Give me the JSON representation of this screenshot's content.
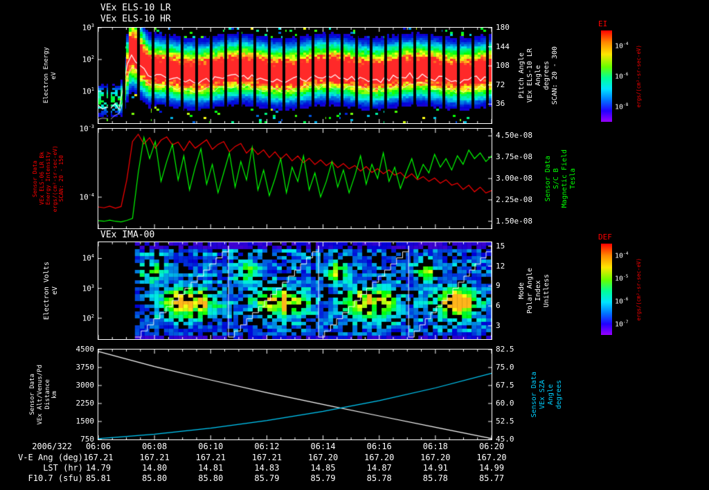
{
  "meta": {
    "background": "#000000",
    "foreground": "#ffffff",
    "accent_red": "#ff0000",
    "accent_green": "#00ff00",
    "accent_cyan": "#00cfff",
    "date": "2006/322",
    "time_range": [
      "06:06",
      "06:20"
    ]
  },
  "titles": {
    "els_line1": "VEx ELS-10 LR",
    "els_line2": "VEx ELS-10 HR",
    "ima": "VEx IMA-00"
  },
  "vertical_labels": {
    "els_left": {
      "color": "#ffffff",
      "lines": [
        "Electron Energy",
        "eV"
      ]
    },
    "els_right": {
      "color": "#ffffff",
      "lines": [
        "Pitch Angle",
        "VEx ELS-10 LR",
        "Angle",
        "degrees",
        "SCAN: 20 - 300"
      ]
    },
    "b_left": {
      "color": "#ff0000",
      "lines": [
        "Sensor Data",
        "VEx ELS-06 LR Bk",
        "Energy Intensity",
        "ergs/(cm²-sr-sec-eV)",
        "SCAN: 20 - 150"
      ]
    },
    "b_right": {
      "color": "#00ff00",
      "lines": [
        "Sensor Data",
        "S/C B",
        "Magnetic Field",
        "Tesla"
      ]
    },
    "ima_left": {
      "color": "#ffffff",
      "lines": [
        "Electron Volts",
        "eV"
      ]
    },
    "ima_right": {
      "color": "#ffffff",
      "lines": [
        "Mode",
        "Polar Angle",
        "Index",
        "Unitless"
      ]
    },
    "traj_left": {
      "color": "#ffffff",
      "lines": [
        "Sensor Data",
        "VEx Alt/Venus/Pd",
        "Distance",
        "km"
      ]
    },
    "traj_right": {
      "color": "#00cfff",
      "lines": [
        "Sensor Data",
        "VEx SZA",
        "Angle",
        "degrees"
      ]
    }
  },
  "colorbars": [
    {
      "title": "EI",
      "units": "ergs/(cm²-sr-sec-eV)",
      "ticks": [
        {
          "label": "10^-4",
          "frac": 0.167
        },
        {
          "label": "10^-6",
          "frac": 0.5
        },
        {
          "label": "10^-8",
          "frac": 0.833
        }
      ]
    },
    {
      "title": "DEF",
      "units": "ergs/(cm²-sr-sec-eV)",
      "ticks": [
        {
          "label": "10^-4",
          "frac": 0.125
        },
        {
          "label": "10^-5",
          "frac": 0.375
        },
        {
          "label": "10^-6",
          "frac": 0.625
        },
        {
          "label": "10^-7",
          "frac": 0.875
        }
      ]
    }
  ],
  "footer": {
    "date_label": "2006/322",
    "time_ticks": [
      "06:06",
      "06:08",
      "06:10",
      "06:12",
      "06:14",
      "06:16",
      "06:18",
      "06:20"
    ],
    "rows": [
      {
        "label": "V-E Ang (deg)",
        "values": [
          "167.21",
          "167.21",
          "167.21",
          "167.21",
          "167.20",
          "167.20",
          "167.20",
          "167.20"
        ]
      },
      {
        "label": "LST (hr)",
        "values": [
          "14.79",
          "14.80",
          "14.81",
          "14.83",
          "14.85",
          "14.87",
          "14.91",
          "14.99"
        ]
      },
      {
        "label": "F10.7 (sfu)",
        "values": [
          "85.81",
          "85.80",
          "85.80",
          "85.79",
          "85.79",
          "85.78",
          "85.78",
          "85.77"
        ]
      }
    ]
  },
  "chart_data": [
    {
      "id": "els_spectrogram",
      "type": "heatmap",
      "title": "VEx ELS-10 LR / VEx ELS-10 HR",
      "xlabel": "UT 06:06 - 06:20 (2006/322)",
      "ylabel": "Electron Energy eV (log)",
      "left_axis": {
        "log": true,
        "lim": [
          1,
          1000
        ],
        "ticks": [
          {
            "v": 1000,
            "label": "10^3"
          },
          {
            "v": 100,
            "label": "10^2"
          },
          {
            "v": 10,
            "label": "10^1"
          }
        ]
      },
      "right_axis": {
        "log": false,
        "lim": [
          0,
          180
        ],
        "label": "Pitch Angle VEx ELS-10 LR Angle degrees SCAN: 20 - 300",
        "ticks": [
          {
            "v": 180,
            "label": "180"
          },
          {
            "v": 144,
            "label": "144"
          },
          {
            "v": 108,
            "label": "108"
          },
          {
            "v": 72,
            "label": "72"
          },
          {
            "v": 36,
            "label": "36"
          }
        ]
      },
      "zunits": "ergs/(cm²-sr-sec-eV)",
      "zticks": [
        "10^-4",
        "10^-6",
        "10^-8"
      ],
      "features": {
        "main_band_eV": [
          8,
          120
        ],
        "band_onset_ut": "06:07",
        "spike_reaches_top": true,
        "scan_gap_count": 26,
        "white_trace": "mean energy line through band"
      },
      "render": {
        "seed": 7,
        "cellw": 4,
        "cellh": 3,
        "gap_start": 14,
        "gap_period": 21,
        "gap_width": 4,
        "quiet_until": 0.055,
        "spike_peak_at": 0.08,
        "settle_at": 0.13,
        "band_center": 0.46,
        "band_sigma": 0.16,
        "gain": 1.35
      }
    },
    {
      "id": "els_intensity_and_b",
      "type": "line",
      "left_axis": {
        "log": true,
        "lim": [
          3.5e-05,
          0.001
        ],
        "units": "ergs/(cm²-sr-sec-eV)",
        "ticks": [
          {
            "v": 0.001,
            "label": "10^-3"
          },
          {
            "v": 0.0001,
            "label": "10^-4"
          }
        ]
      },
      "right_axis": {
        "log": false,
        "lim": [
          1.25e-08,
          4.75e-08
        ],
        "units": "Tesla",
        "ticks": [
          {
            "v": 4.5e-08,
            "label": "4.50e-08"
          },
          {
            "v": 3.75e-08,
            "label": "3.75e-08"
          },
          {
            "v": 3e-08,
            "label": "3.00e-08"
          },
          {
            "v": 2.25e-08,
            "label": "2.25e-08"
          },
          {
            "v": 1.5e-08,
            "label": "1.50e-08"
          }
        ]
      },
      "series": [
        {
          "name": "VEx ELS-06 LR Bk Energy Intensity",
          "color": "#ff0000",
          "axis": "left",
          "scale": 0.0001,
          "values": [
            0.72,
            0.7,
            0.74,
            0.69,
            0.73,
            1.8,
            6.5,
            8.3,
            6.0,
            7.4,
            5.2,
            6.8,
            7.6,
            5.8,
            6.4,
            4.8,
            6.6,
            5.2,
            6.0,
            6.9,
            5.0,
            5.9,
            6.5,
            4.6,
            5.5,
            6.1,
            4.4,
            5.3,
            4.2,
            4.9,
            3.8,
            4.6,
            3.6,
            4.3,
            3.4,
            4.0,
            3.2,
            3.7,
            3.0,
            3.5,
            2.9,
            3.3,
            2.7,
            3.1,
            2.6,
            2.9,
            2.4,
            2.8,
            2.3,
            2.6,
            2.2,
            2.5,
            2.1,
            2.3,
            1.9,
            2.2,
            1.8,
            2.0,
            1.7,
            1.9,
            1.6,
            1.8,
            1.5,
            1.6,
            1.3,
            1.5,
            1.2,
            1.4,
            1.15,
            1.25
          ]
        },
        {
          "name": "S/C B Magnetic Field",
          "color": "#00ff00",
          "axis": "right",
          "scale": 1e-08,
          "values": [
            1.52,
            1.5,
            1.54,
            1.5,
            1.48,
            1.53,
            1.6,
            3.2,
            4.45,
            3.7,
            4.3,
            2.9,
            3.6,
            4.2,
            2.95,
            3.8,
            2.6,
            3.4,
            4.05,
            2.8,
            3.5,
            2.5,
            3.2,
            3.9,
            2.7,
            3.6,
            2.95,
            4.1,
            2.6,
            3.3,
            2.4,
            3.0,
            3.7,
            2.5,
            3.4,
            2.9,
            3.8,
            2.6,
            3.2,
            2.35,
            2.9,
            3.6,
            2.7,
            3.3,
            2.5,
            3.1,
            3.8,
            2.8,
            3.5,
            3.0,
            3.9,
            2.9,
            3.4,
            2.65,
            3.2,
            3.7,
            3.0,
            3.5,
            3.2,
            3.85,
            3.4,
            3.7,
            3.3,
            3.8,
            3.5,
            4.0,
            3.7,
            3.9,
            3.6,
            3.8
          ]
        }
      ]
    },
    {
      "id": "ima_spectrogram",
      "type": "heatmap",
      "title": "VEx IMA-00",
      "ylabel": "Electron Volts eV (log)",
      "left_axis": {
        "log": true,
        "lim": [
          20,
          35000
        ],
        "ticks": [
          {
            "v": 10000,
            "label": "10^4"
          },
          {
            "v": 1000,
            "label": "10^3"
          },
          {
            "v": 100,
            "label": "10^2"
          }
        ]
      },
      "right_axis": {
        "log": false,
        "lim": [
          1,
          15.6
        ],
        "label": "Mode Polar Angle Index Unitless",
        "ticks": [
          {
            "v": 15,
            "label": "15"
          },
          {
            "v": 12,
            "label": "12"
          },
          {
            "v": 9,
            "label": "9"
          },
          {
            "v": 6,
            "label": "6"
          },
          {
            "v": 3,
            "label": "3"
          }
        ]
      },
      "zunits": "ergs/(cm²-sr-sec-eV)",
      "zticks": [
        "10^-4",
        "10^-5",
        "10^-6",
        "10^-7"
      ],
      "features": {
        "data_start_frac": 0.093,
        "cycle_boundaries_frac": [
          0.093,
          0.331,
          0.56,
          0.789,
          1.0
        ],
        "polar_angle_sweep": "sawtooth staircase 0-15 per cycle (white line)",
        "bright_core_eV": [
          100,
          1000
        ]
      },
      "render": {
        "seed": 12,
        "cellw": 7,
        "cellh": 5,
        "blob_cx": 0.55,
        "blob_sx": 0.27,
        "blob_cy": 0.62,
        "blob_sy": 0.14,
        "steps": 15
      }
    },
    {
      "id": "trajectory",
      "type": "line",
      "x_ticklabels": [
        "06:06",
        "06:08",
        "06:10",
        "06:12",
        "06:14",
        "06:16",
        "06:18",
        "06:20"
      ],
      "left_axis": {
        "log": false,
        "lim": [
          750,
          4500
        ],
        "ticks": [
          {
            "v": 4500,
            "label": "4500"
          },
          {
            "v": 3750,
            "label": "3750"
          },
          {
            "v": 3000,
            "label": "3000"
          },
          {
            "v": 2250,
            "label": "2250"
          },
          {
            "v": 1500,
            "label": "1500"
          },
          {
            "v": 750,
            "label": "750"
          }
        ]
      },
      "right_axis": {
        "log": false,
        "lim": [
          45,
          82.5
        ],
        "ticks": [
          {
            "v": 82.5,
            "label": "82.5"
          },
          {
            "v": 75,
            "label": "75.0"
          },
          {
            "v": 67.5,
            "label": "67.5"
          },
          {
            "v": 60,
            "label": "60.0"
          },
          {
            "v": 52.5,
            "label": "52.5"
          },
          {
            "v": 45,
            "label": "45.0"
          }
        ]
      },
      "series": [
        {
          "name": "VEx Alt/Venus/Pd Distance (km)",
          "color": "#ffffff",
          "axis": "left",
          "values": [
            4420,
            3790,
            3230,
            2700,
            2210,
            1730,
            1260,
            790
          ]
        },
        {
          "name": "VEx SZA Angle (degrees)",
          "color": "#00cfff",
          "axis": "right",
          "values": [
            45.3,
            47.2,
            49.7,
            52.9,
            56.7,
            61.2,
            66.5,
            72.6
          ]
        }
      ]
    }
  ]
}
